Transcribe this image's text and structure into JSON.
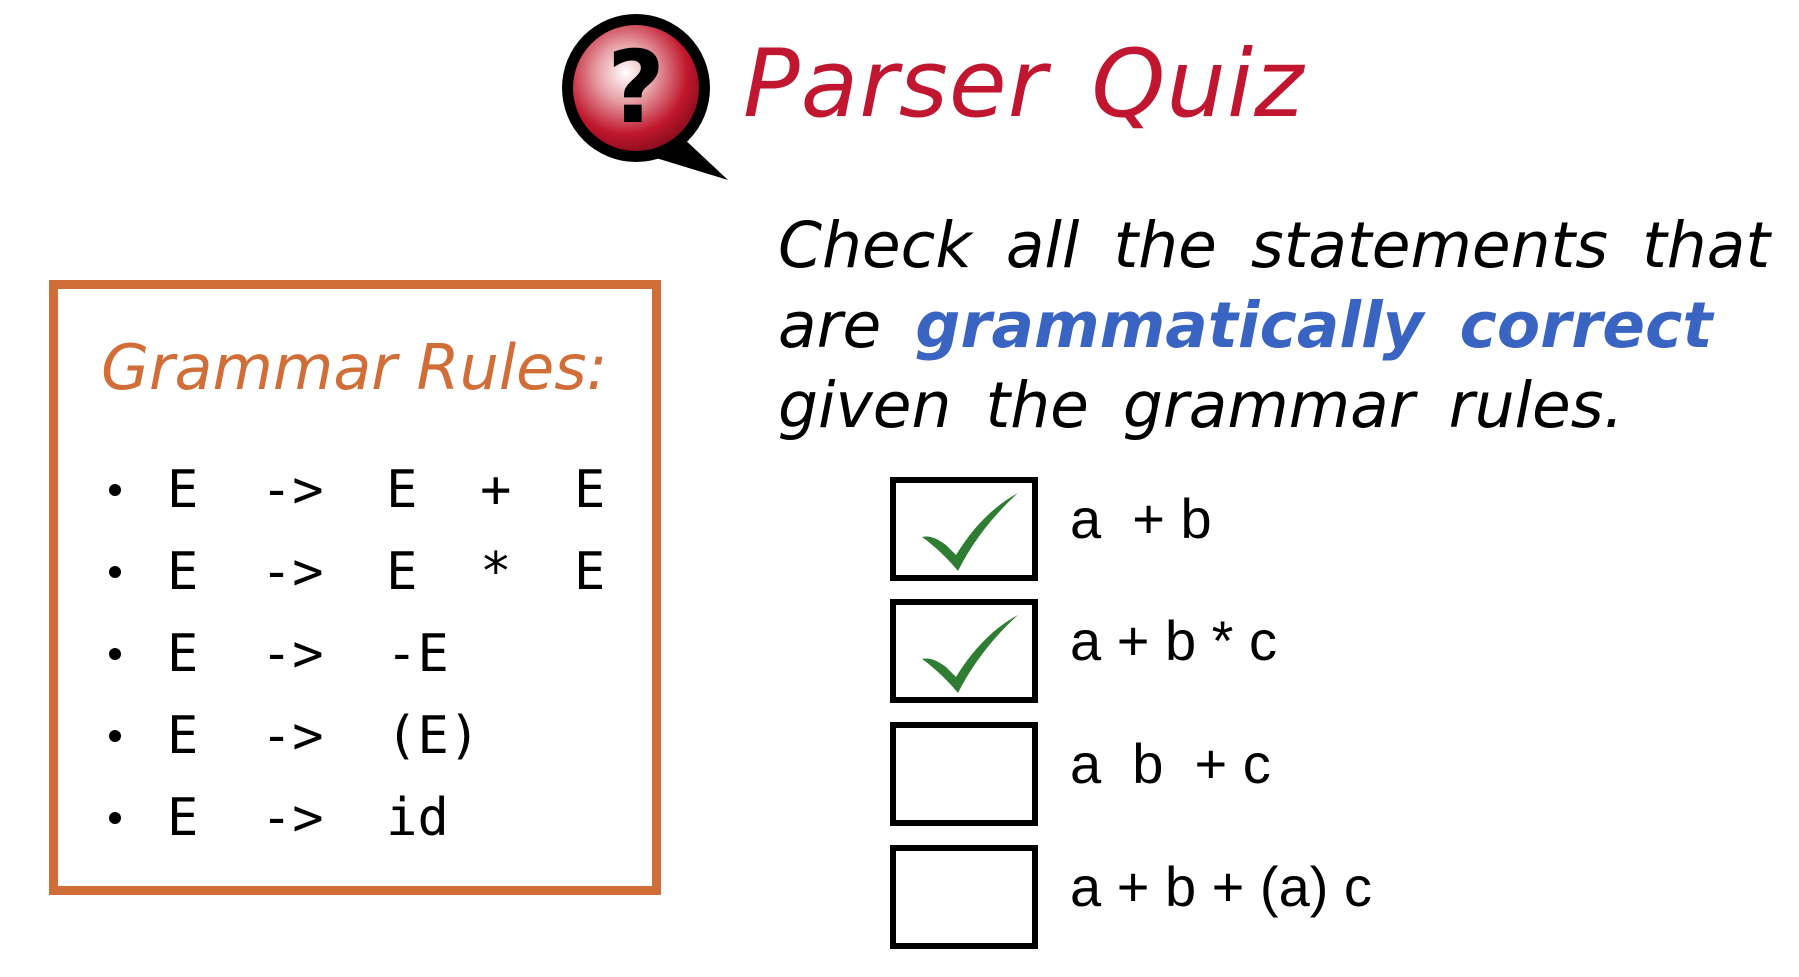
{
  "header": {
    "icon": "question-speech-bubble-icon",
    "title_word1": "Parser",
    "title_word2": "Quiz",
    "title_color": "#c1162f"
  },
  "rules": {
    "title": "Grammar Rules:",
    "border_color": "#d16e38",
    "items": [
      "E  ->  E  +  E",
      "E  ->  E  *  E",
      "E  ->  -E",
      "E  ->  (E)",
      "E  ->  id"
    ]
  },
  "instruction": {
    "before": "Check all the statements that are ",
    "highlight": "grammatically correct",
    "after": " given the grammar rules.",
    "highlight_color": "#3a64c2"
  },
  "options": [
    {
      "label": "a  + b",
      "checked": true
    },
    {
      "label": "a + b * c",
      "checked": true
    },
    {
      "label": "a  b  + c",
      "checked": false
    },
    {
      "label": "a + b + (a) c",
      "checked": false
    }
  ],
  "check_color": "#2e7d32"
}
